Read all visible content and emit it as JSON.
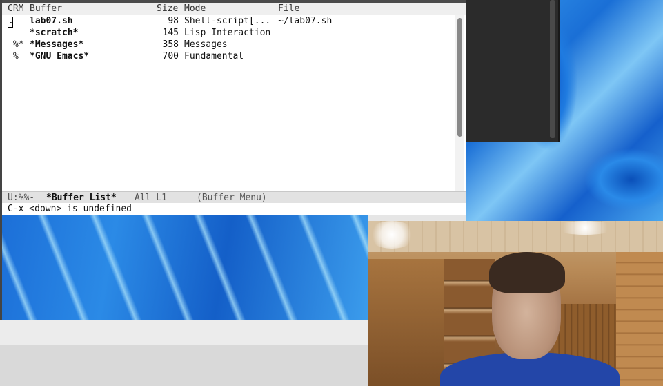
{
  "header": {
    "crm": "CRM",
    "buffer": "Buffer",
    "size": "Size",
    "mode": "Mode",
    "file": "File"
  },
  "buffers": [
    {
      "crm": ".",
      "name": "lab07.sh",
      "size": "98",
      "mode": "Shell-script[...",
      "file": "~/lab07.sh",
      "current": true
    },
    {
      "crm": "",
      "name": "*scratch*",
      "size": "145",
      "mode": "Lisp Interaction",
      "file": ""
    },
    {
      "crm": "%*",
      "name": "*Messages*",
      "size": "358",
      "mode": "Messages",
      "file": ""
    },
    {
      "crm": "%",
      "name": "*GNU Emacs*",
      "size": "700",
      "mode": "Fundamental",
      "file": ""
    }
  ],
  "mode_line": {
    "status": "U:%%-",
    "buffer_name": "*Buffer List*",
    "position": "All L1",
    "major_mode": "(Buffer Menu)"
  },
  "echo_area": {
    "message": "C-x <down> is undefined"
  }
}
